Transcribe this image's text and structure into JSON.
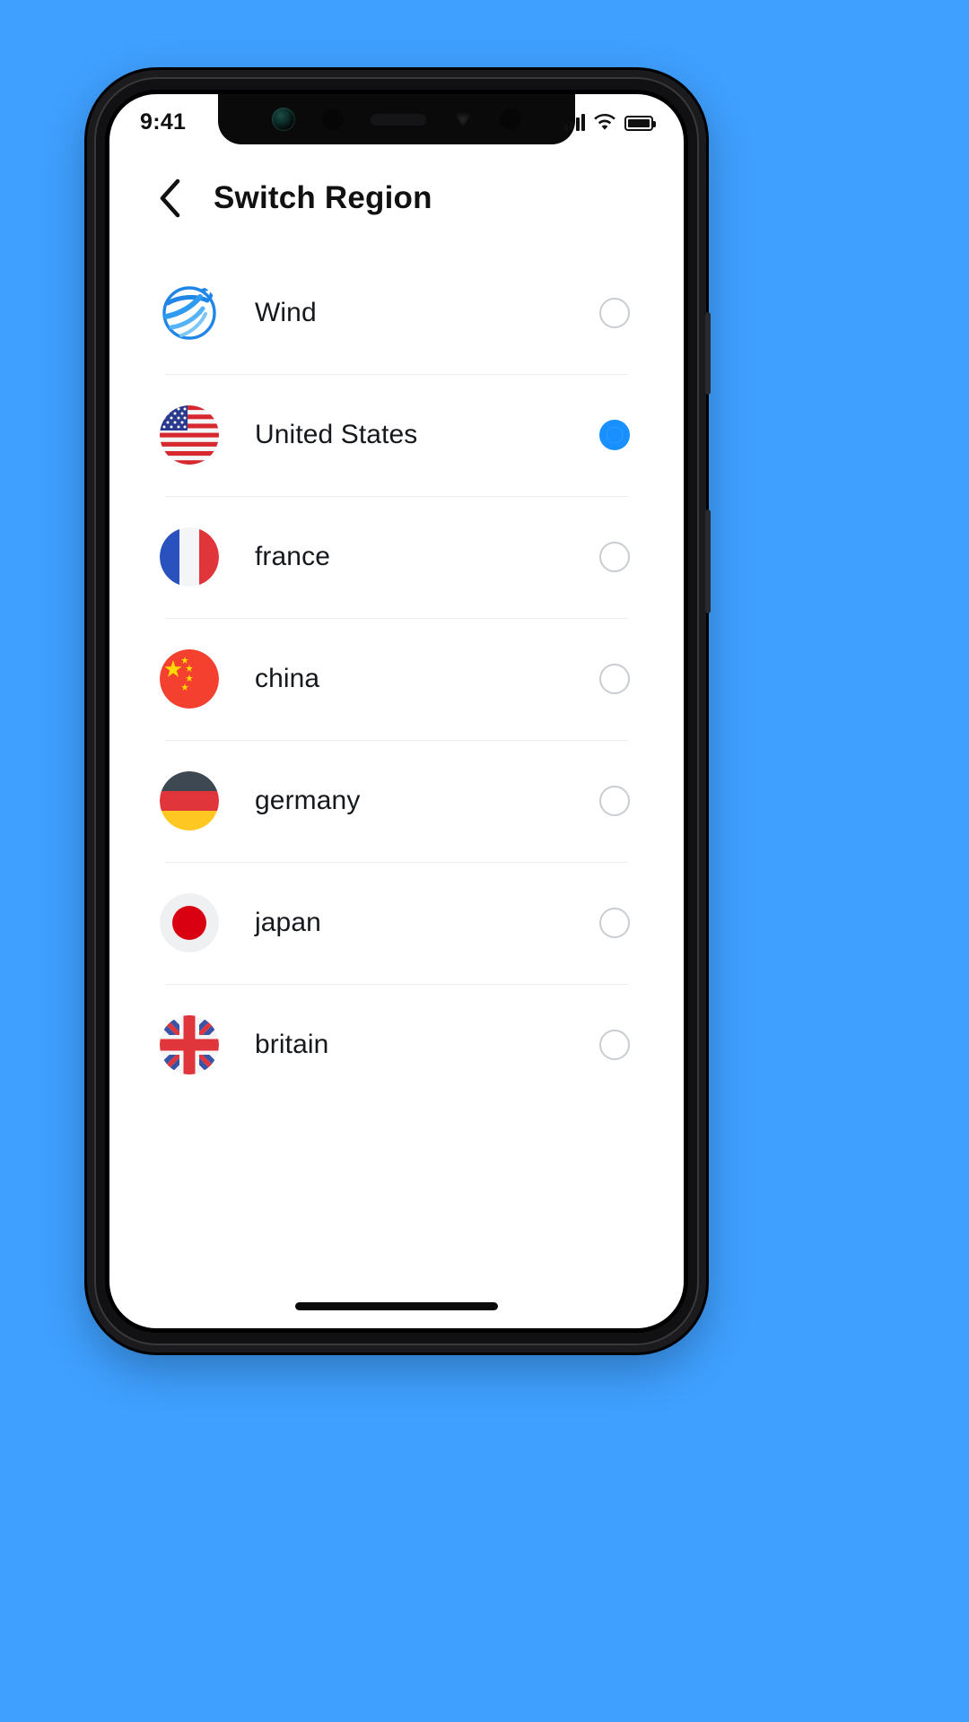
{
  "theme": {
    "background": "#3fa0ff",
    "accent": "#1890ff",
    "phone_frame": "#1b1b1d",
    "screen_bg": "#ffffff",
    "divider": "#ececec",
    "text_primary": "#15181c",
    "radio_border": "#c9cdd2"
  },
  "status_bar": {
    "time": "9:41",
    "signal_icon": "signal-bars-icon",
    "wifi_icon": "wifi-icon",
    "battery_icon": "battery-full-icon"
  },
  "header": {
    "back_icon": "chevron-left-icon",
    "title": "Switch Region"
  },
  "regions": [
    {
      "id": "wind",
      "label": "Wind",
      "flag": "wind-globe-icon",
      "selected": false
    },
    {
      "id": "united-states",
      "label": "United States",
      "flag": "flag-us-icon",
      "selected": true
    },
    {
      "id": "france",
      "label": "france",
      "flag": "flag-france-icon",
      "selected": false
    },
    {
      "id": "china",
      "label": "china",
      "flag": "flag-china-icon",
      "selected": false
    },
    {
      "id": "germany",
      "label": "germany",
      "flag": "flag-germany-icon",
      "selected": false
    },
    {
      "id": "japan",
      "label": "japan",
      "flag": "flag-japan-icon",
      "selected": false
    },
    {
      "id": "britain",
      "label": "britain",
      "flag": "flag-britain-icon",
      "selected": false
    }
  ],
  "home_indicator": "home-indicator-bar"
}
